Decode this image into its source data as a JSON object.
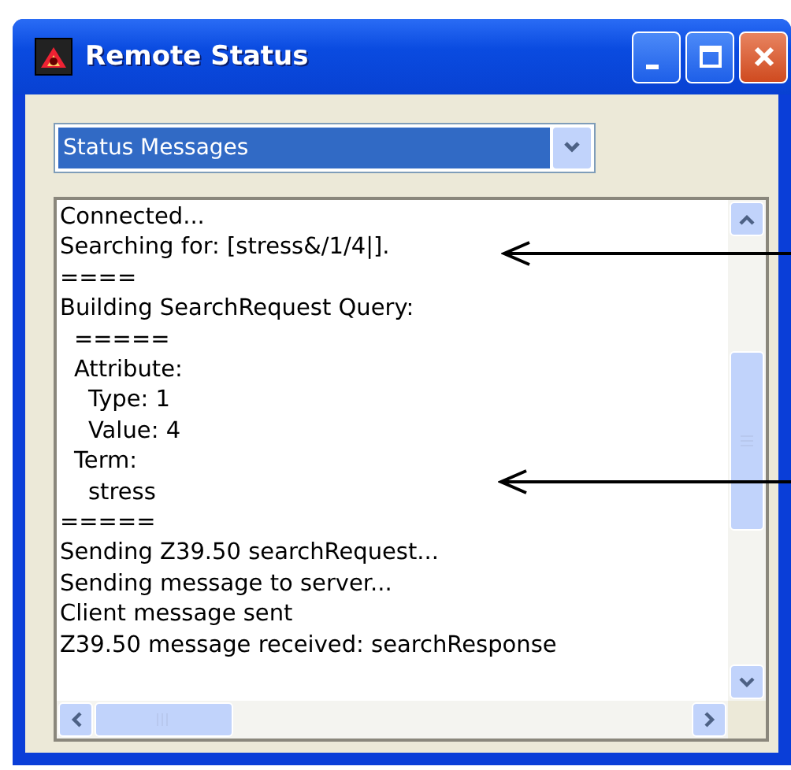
{
  "window": {
    "title": "Remote Status"
  },
  "dropdown": {
    "value": "Status Messages"
  },
  "log": {
    "lines": [
      {
        "text": "Connected..."
      },
      {
        "text": "Searching for: [stress&/1/4|]."
      },
      {
        "text": "===="
      },
      {
        "text": "Building SearchRequest Query:",
        "children": [
          {
            "text": "====="
          },
          {
            "text": "Attribute:",
            "children": [
              {
                "text": "Type: 1"
              },
              {
                "text": "Value: 4"
              }
            ]
          },
          {
            "text": "Term:",
            "children": [
              {
                "text": "stress"
              }
            ]
          }
        ]
      },
      {
        "text": "====="
      },
      {
        "text": "Sending Z39.50 searchRequest..."
      },
      {
        "text": "Sending message to server..."
      },
      {
        "text": "Client message sent"
      },
      {
        "text": "Z39.50 message received: searchResponse"
      }
    ]
  }
}
